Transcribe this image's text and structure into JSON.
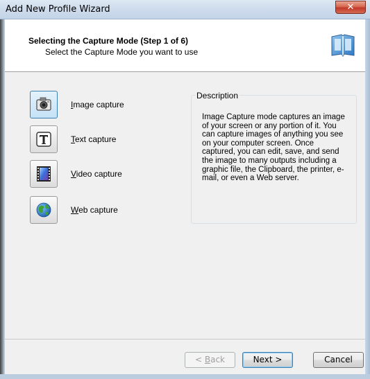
{
  "window": {
    "title": "Add New Profile Wizard",
    "close_glyph": "✕"
  },
  "header": {
    "title": "Selecting the Capture Mode (Step 1 of 6)",
    "subtitle": "Select the Capture Mode you want to use",
    "icon": "wizard-book-icon"
  },
  "modes": [
    {
      "key": "I",
      "rest": "mage capture",
      "icon": "camera-icon",
      "selected": true
    },
    {
      "key": "T",
      "rest": "ext capture",
      "icon": "text-t-icon",
      "selected": false
    },
    {
      "key": "V",
      "rest": "ideo capture",
      "icon": "film-strip-icon",
      "selected": false
    },
    {
      "key": "W",
      "rest": "eb capture",
      "icon": "globe-icon",
      "selected": false
    }
  ],
  "description": {
    "legend": "Description",
    "text": "Image Capture mode captures an image of your screen or any portion of it. You can capture images of anything you see on your computer screen. Once captured, you can edit, save, and send the image to many outputs including a graphic file, the Clipboard, the printer, e-mail, or even a Web server."
  },
  "buttons": {
    "back_key": "B",
    "back_pre": "< ",
    "back_rest": "ack",
    "next": "Next >",
    "cancel": "Cancel"
  },
  "colors": {
    "selected_border": "#3c7fb1",
    "close": "#c0392b"
  }
}
